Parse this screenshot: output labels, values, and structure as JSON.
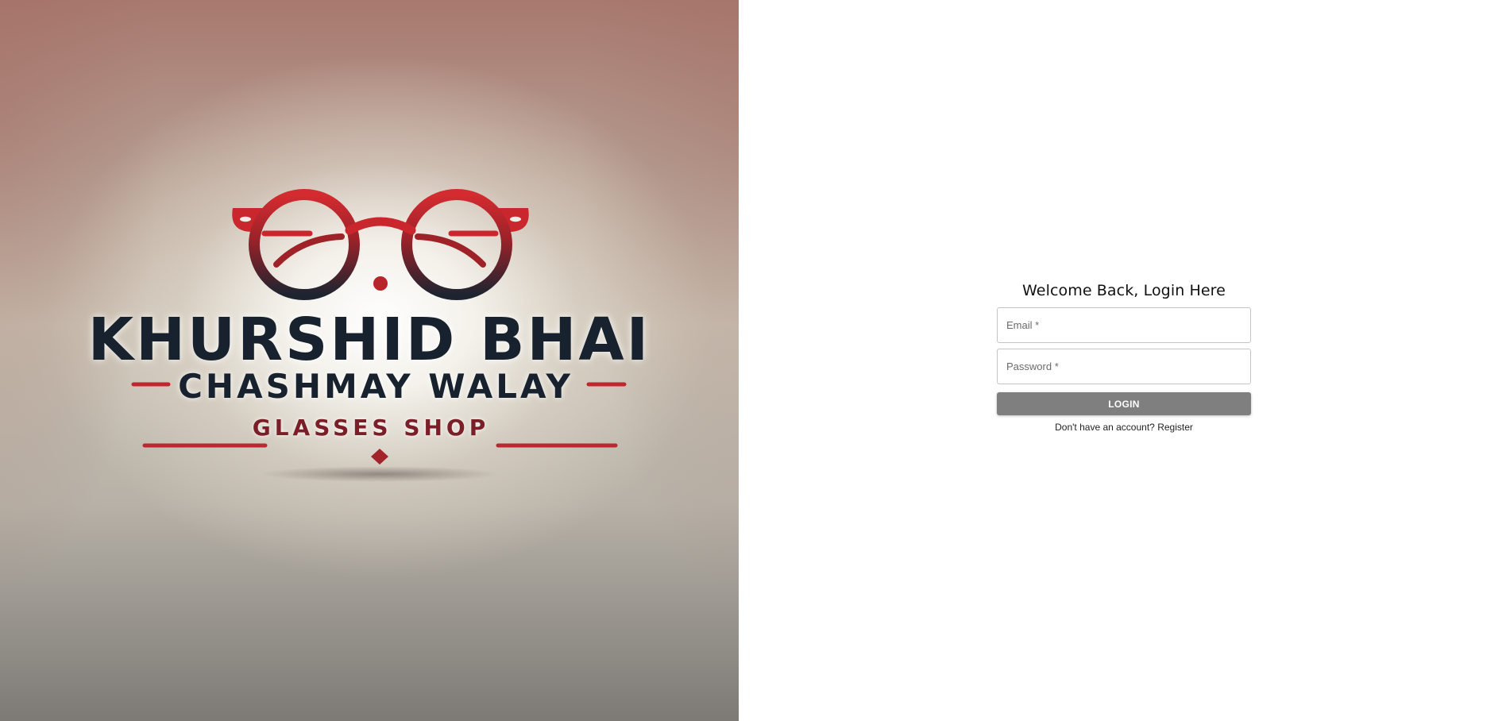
{
  "hero": {
    "logo": {
      "line_1": "KHURSHID BHAI",
      "line_2": "CHASHMAY WALAY",
      "line_3": "GLASSES SHOP",
      "icon": "eyeglasses-icon",
      "accent_color": "#c0262d",
      "text_color": "#17222e"
    }
  },
  "login": {
    "title": "Welcome Back, Login Here",
    "email_placeholder": "Email *",
    "email_value": "",
    "password_placeholder": "Password *",
    "password_value": "",
    "button_label": "LOGIN",
    "button_color": "#7f7f7f",
    "register_prompt": "Don't have an account?",
    "register_link": "Register"
  }
}
